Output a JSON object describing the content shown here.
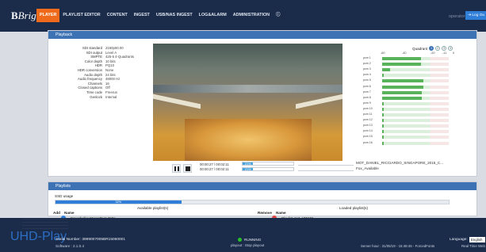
{
  "app": {
    "logo_main": "Bright",
    "logo_prefix": "B"
  },
  "nav": {
    "items": [
      "PLAYER",
      "PLAYLIST EDITOR",
      "CONTENT",
      "INGEST",
      "USB/NAS INGEST",
      "LOG&ALARM",
      "ADMINISTRATION"
    ],
    "info_glyph": "ⓘ",
    "active_index": 0
  },
  "user": {
    "operator": "operator",
    "logout_label": "Log Ou"
  },
  "playback": {
    "title": "Playback",
    "meta": [
      {
        "k": "SDI standard",
        "v": "2160p50.00"
      },
      {
        "k": "SDI output",
        "v": "Level A"
      },
      {
        "k": "SMPTE",
        "v": "425-5 4-Quadrants"
      },
      {
        "k": "Color depth",
        "v": "10 bits"
      },
      {
        "k": "HDR",
        "v": "PQ10"
      },
      {
        "k": "HDR conversion",
        "v": "None"
      },
      {
        "k": "Audio depth",
        "v": "24 bits"
      },
      {
        "k": "Audio frequency",
        "v": "48000 Hz"
      },
      {
        "k": "Channels",
        "v": "16"
      },
      {
        "k": "Closed captions",
        "v": "Off"
      },
      {
        "k": "Time code",
        "v": "Freerun"
      },
      {
        "k": "Genlock",
        "v": "Internal"
      }
    ],
    "timecode1": "00:00:27 / 00:02:11",
    "timecode2": "00:00:27 / 00:02:11",
    "progress1": 21,
    "progress1_label": "21%",
    "progress2": 21,
    "progress2_label": "21%",
    "clip_current": "MOT_DANIEL_RICCIARDO_SINGAPORE_2015_C...",
    "clip_next": "Fox_Available"
  },
  "audio": {
    "quadrant_label": "Quadrant",
    "quadrants": [
      "1",
      "2",
      "3",
      "4"
    ],
    "active_quadrant": 0,
    "scale": [
      "-60",
      "-40",
      "-20",
      "-11",
      "0"
    ],
    "channels": [
      {
        "label": "pcm 1",
        "level": 0.58
      },
      {
        "label": "pcm 2",
        "level": 0.58
      },
      {
        "label": "pcm 3",
        "level": 0.12
      },
      {
        "label": "pcm 4",
        "level": 0.02
      },
      {
        "label": "pcm 5",
        "level": 0.62
      },
      {
        "label": "pcm 6",
        "level": 0.62
      },
      {
        "label": "pcm 7",
        "level": 0.6
      },
      {
        "label": "pcm 8",
        "level": 0.6
      },
      {
        "label": "pcm 9",
        "level": 0.02
      },
      {
        "label": "pcm 10",
        "level": 0.02
      },
      {
        "label": "pcm 11",
        "level": 0.02
      },
      {
        "label": "pcm 12",
        "level": 0.02
      },
      {
        "label": "pcm 13",
        "level": 0.02
      },
      {
        "label": "pcm 14",
        "level": 0.02
      },
      {
        "label": "pcm 15",
        "level": 0.02
      },
      {
        "label": "pcm 16",
        "level": 0.02
      }
    ]
  },
  "playlists": {
    "title": "Playlists",
    "ssd_label": "SSD usage",
    "ssd_percent": 32,
    "ssd_percent_label": "32%",
    "available_label": "Available playlist(s)",
    "loaded_label": "Loaded playlist(s)",
    "available_headers": [
      "Add",
      "Name"
    ],
    "loaded_headers": [
      "Remove",
      "Name"
    ],
    "available": [
      "Fraunhofer StressTest 720p",
      "UHD"
    ],
    "loaded": [
      "Playlist AV1 ATEME",
      "Playlist HDR ATEME"
    ]
  },
  "footer": {
    "brand": "UHD-Play",
    "serial": "Serial Number: 3999007005BR15060001",
    "software": "Software : 2.1.0.4",
    "status": "RUNNING",
    "status_sub": "playout : Stop playout",
    "language_label": "Language:",
    "language_value": "English",
    "server_time": "Server hour : 31/05/19 - 15:48:45 - ForcedFonts",
    "real_time": "Real Time Web"
  },
  "colors": {
    "accent": "#ef6a1a",
    "header": "#1b2b4a",
    "panel_head": "#3d73b5",
    "meter": "#58b35a"
  }
}
